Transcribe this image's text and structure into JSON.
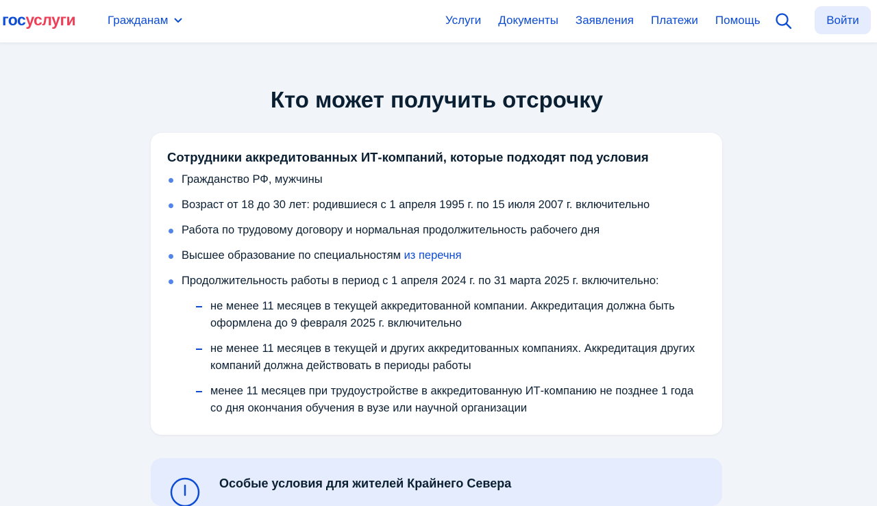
{
  "header": {
    "logo": {
      "part1": "гос",
      "part2": "услуги"
    },
    "audience_label": "Гражданам",
    "nav": [
      "Услуги",
      "Документы",
      "Заявления",
      "Платежи",
      "Помощь"
    ],
    "login_label": "Войти"
  },
  "main": {
    "title": "Кто может получить отсрочку",
    "card": {
      "title": "Сотрудники аккредитованных ИТ-компаний, которые подходят под условия",
      "conditions": [
        "Гражданство РФ, мужчины",
        "Возраст от 18 до 30 лет: родившиеся с 1 апреля 1995 г. по 15 июля 2007 г. включительно",
        "Работа по трудовому договору и нормальная продолжительность рабочего дня",
        "Высшее образование по специальностям",
        "Продолжительность работы в период с 1 апреля 2024 г. по 31 марта 2025 г. включительно:"
      ],
      "education_link": "из перечня",
      "subconditions": [
        "не менее 11 месяцев в текущей аккредитованной компании. Аккредитация должна быть оформлена до 9 февраля 2025 г. включительно",
        "не менее 11 месяцев в текущей и других аккредитованных компаниях. Аккредитация других компаний должна действовать в периоды работы",
        "менее 11 месяцев при трудоустройстве в аккредитованную ИТ-компанию не позднее 1 года со дня окончания обучения в вузе или научной организации"
      ]
    },
    "notice": {
      "title": "Особые условия для жителей Крайнего Севера"
    }
  },
  "colors": {
    "brand_blue": "#0d4cd3",
    "brand_red": "#ee3f58",
    "page_background": "#f1f4f9",
    "bullet_blue": "#5384e8",
    "notice_background": "#e4ecfd"
  },
  "icons": [
    "chevron-down-icon",
    "search-icon",
    "info-icon"
  ]
}
